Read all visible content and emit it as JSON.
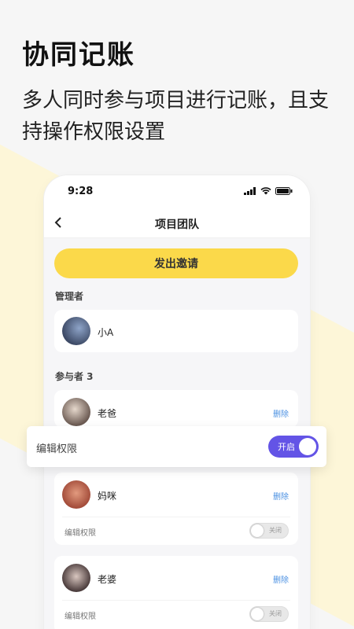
{
  "headline": "协同记账",
  "subline": "多人同时参与项目进行记账，且支持操作权限设置",
  "phone": {
    "status_time": "9:28",
    "nav_title": "项目团队",
    "invite_button": "发出邀请",
    "admin_section": "管理者",
    "admin": {
      "name": "小A"
    },
    "participants_section": "参与者 3",
    "members": [
      {
        "name": "老爸",
        "delete": "删除",
        "perm_label": "编辑权限",
        "perm_state": "开启"
      },
      {
        "name": "妈咪",
        "delete": "删除",
        "perm_label": "编辑权限",
        "perm_state": "关闭"
      },
      {
        "name": "老婆",
        "delete": "删除",
        "perm_label": "编辑权限",
        "perm_state": "关闭"
      }
    ]
  },
  "colors": {
    "accent_yellow": "#fbd94a",
    "toggle_on": "#6354e6",
    "delete_link": "#4a90e2"
  }
}
